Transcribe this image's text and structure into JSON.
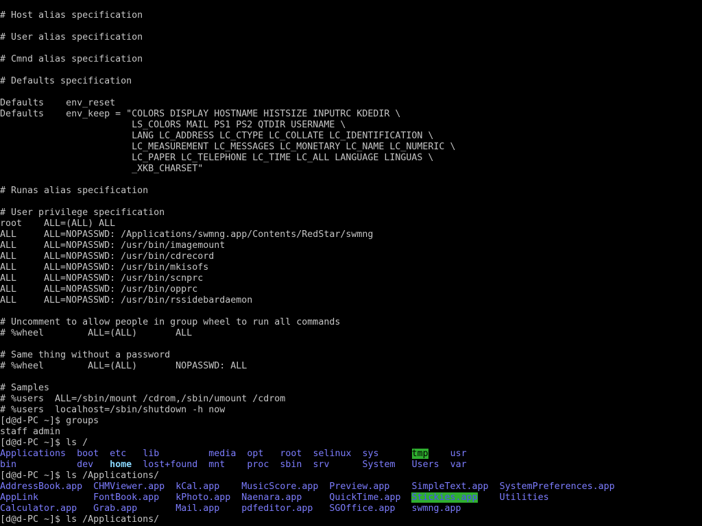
{
  "terminal": {
    "lines": [
      [
        {
          "t": "# Host alias specification"
        }
      ],
      [
        {
          "t": ""
        }
      ],
      [
        {
          "t": "# User alias specification"
        }
      ],
      [
        {
          "t": ""
        }
      ],
      [
        {
          "t": "# Cmnd alias specification"
        }
      ],
      [
        {
          "t": ""
        }
      ],
      [
        {
          "t": "# Defaults specification"
        }
      ],
      [
        {
          "t": ""
        }
      ],
      [
        {
          "t": "Defaults    env_reset"
        }
      ],
      [
        {
          "t": "Defaults    env_keep = \"COLORS DISPLAY HOSTNAME HISTSIZE INPUTRC KDEDIR \\"
        }
      ],
      [
        {
          "t": "                        LS_COLORS MAIL PS1 PS2 QTDIR USERNAME \\"
        }
      ],
      [
        {
          "t": "                        LANG LC_ADDRESS LC_CTYPE LC_COLLATE LC_IDENTIFICATION \\"
        }
      ],
      [
        {
          "t": "                        LC_MEASUREMENT LC_MESSAGES LC_MONETARY LC_NAME LC_NUMERIC \\"
        }
      ],
      [
        {
          "t": "                        LC_PAPER LC_TELEPHONE LC_TIME LC_ALL LANGUAGE LINGUAS \\"
        }
      ],
      [
        {
          "t": "                        _XKB_CHARSET\""
        }
      ],
      [
        {
          "t": ""
        }
      ],
      [
        {
          "t": "# Runas alias specification"
        }
      ],
      [
        {
          "t": ""
        }
      ],
      [
        {
          "t": "# User privilege specification"
        }
      ],
      [
        {
          "t": "root    ALL=(ALL) ALL"
        }
      ],
      [
        {
          "t": "ALL     ALL=NOPASSWD: /Applications/swmng.app/Contents/RedStar/swmng"
        }
      ],
      [
        {
          "t": "ALL     ALL=NOPASSWD: /usr/bin/imagemount"
        }
      ],
      [
        {
          "t": "ALL     ALL=NOPASSWD: /usr/bin/cdrecord"
        }
      ],
      [
        {
          "t": "ALL     ALL=NOPASSWD: /usr/bin/mkisofs"
        }
      ],
      [
        {
          "t": "ALL     ALL=NOPASSWD: /usr/bin/scnprc"
        }
      ],
      [
        {
          "t": "ALL     ALL=NOPASSWD: /usr/bin/opprc"
        }
      ],
      [
        {
          "t": "ALL     ALL=NOPASSWD: /usr/bin/rssidebardaemon"
        }
      ],
      [
        {
          "t": ""
        }
      ],
      [
        {
          "t": "# Uncomment to allow people in group wheel to run all commands"
        }
      ],
      [
        {
          "t": "# %wheel        ALL=(ALL)       ALL"
        }
      ],
      [
        {
          "t": ""
        }
      ],
      [
        {
          "t": "# Same thing without a password"
        }
      ],
      [
        {
          "t": "# %wheel        ALL=(ALL)       NOPASSWD: ALL"
        }
      ],
      [
        {
          "t": ""
        }
      ],
      [
        {
          "t": "# Samples"
        }
      ],
      [
        {
          "t": "# %users  ALL=/sbin/mount /cdrom,/sbin/umount /cdrom"
        }
      ],
      [
        {
          "t": "# %users  localhost=/sbin/shutdown -h now"
        }
      ],
      [
        {
          "t": "[d@d-PC ~]$ groups"
        }
      ],
      [
        {
          "t": "staff admin"
        }
      ],
      [
        {
          "t": "[d@d-PC ~]$ ls /"
        }
      ],
      [
        {
          "t": "Applications",
          "c": "dir"
        },
        {
          "t": "  "
        },
        {
          "t": "boot",
          "c": "dir"
        },
        {
          "t": "  "
        },
        {
          "t": "etc",
          "c": "dir"
        },
        {
          "t": "   "
        },
        {
          "t": "lib",
          "c": "dir"
        },
        {
          "t": "         "
        },
        {
          "t": "media",
          "c": "dir"
        },
        {
          "t": "  "
        },
        {
          "t": "opt",
          "c": "dir"
        },
        {
          "t": "   "
        },
        {
          "t": "root",
          "c": "dir"
        },
        {
          "t": "  "
        },
        {
          "t": "selinux",
          "c": "dir"
        },
        {
          "t": "  "
        },
        {
          "t": "sys",
          "c": "dir"
        },
        {
          "t": "      "
        },
        {
          "t": "tmp",
          "c": "tmp"
        },
        {
          "t": "    "
        },
        {
          "t": "usr",
          "c": "dir"
        }
      ],
      [
        {
          "t": "bin",
          "c": "dir"
        },
        {
          "t": "           "
        },
        {
          "t": "dev",
          "c": "dir"
        },
        {
          "t": "   "
        },
        {
          "t": "home",
          "c": "home"
        },
        {
          "t": "  "
        },
        {
          "t": "lost+found",
          "c": "dir"
        },
        {
          "t": "  "
        },
        {
          "t": "mnt",
          "c": "dir"
        },
        {
          "t": "    "
        },
        {
          "t": "proc",
          "c": "dir"
        },
        {
          "t": "  "
        },
        {
          "t": "sbin",
          "c": "dir"
        },
        {
          "t": "  "
        },
        {
          "t": "srv",
          "c": "dir"
        },
        {
          "t": "      "
        },
        {
          "t": "System",
          "c": "dir"
        },
        {
          "t": "   "
        },
        {
          "t": "Users",
          "c": "dir"
        },
        {
          "t": "  "
        },
        {
          "t": "var",
          "c": "dir"
        }
      ],
      [
        {
          "t": "[d@d-PC ~]$ ls /Applications/"
        }
      ],
      [
        {
          "t": "AddressBook.app",
          "c": "dir"
        },
        {
          "t": "  "
        },
        {
          "t": "CHMViewer.app",
          "c": "dir"
        },
        {
          "t": "  "
        },
        {
          "t": "kCal.app",
          "c": "dir"
        },
        {
          "t": "    "
        },
        {
          "t": "MusicScore.app",
          "c": "dir"
        },
        {
          "t": "  "
        },
        {
          "t": "Preview.app",
          "c": "dir"
        },
        {
          "t": "    "
        },
        {
          "t": "SimpleText.app",
          "c": "dir"
        },
        {
          "t": "  "
        },
        {
          "t": "SystemPreferences.app",
          "c": "dir"
        }
      ],
      [
        {
          "t": "AppLink",
          "c": "dir"
        },
        {
          "t": "          "
        },
        {
          "t": "FontBook.app",
          "c": "dir"
        },
        {
          "t": "   "
        },
        {
          "t": "kPhoto.app",
          "c": "dir"
        },
        {
          "t": "  "
        },
        {
          "t": "Naenara.app",
          "c": "dir"
        },
        {
          "t": "     "
        },
        {
          "t": "QuickTime.app",
          "c": "dir"
        },
        {
          "t": "  "
        },
        {
          "t": "Stickies.app",
          "c": "stickies"
        },
        {
          "t": "    "
        },
        {
          "t": "Utilities",
          "c": "dir"
        }
      ],
      [
        {
          "t": "Calculator.app",
          "c": "dir"
        },
        {
          "t": "   "
        },
        {
          "t": "Grab.app",
          "c": "dir"
        },
        {
          "t": "       "
        },
        {
          "t": "Mail.app",
          "c": "dir"
        },
        {
          "t": "    "
        },
        {
          "t": "pdfeditor.app",
          "c": "dir"
        },
        {
          "t": "   "
        },
        {
          "t": "SGOffice.app",
          "c": "dir"
        },
        {
          "t": "   "
        },
        {
          "t": "swmng.app",
          "c": "dir"
        }
      ],
      [
        {
          "t": "[d@d-PC ~]$ ls /Applications/"
        }
      ]
    ]
  }
}
